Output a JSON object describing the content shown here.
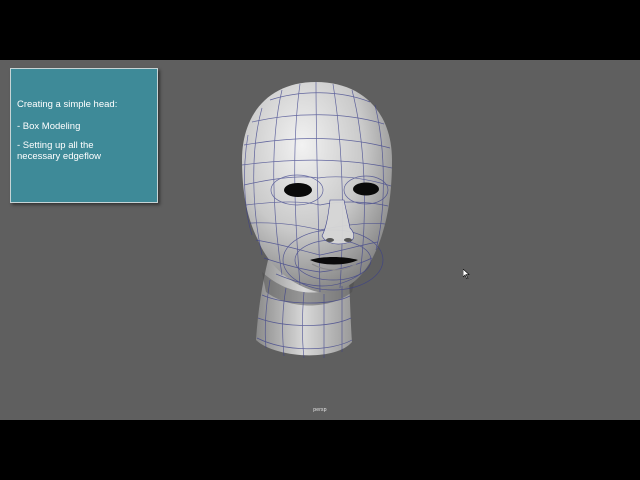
{
  "overlay": {
    "title": "Creating a simple head:",
    "bullets": [
      "- Box Modeling",
      "- Setting up all the\nnecessary edgeflow"
    ]
  },
  "viewport": {
    "camera_label": "persp",
    "background_color": "#5f5f5f",
    "panel_color": "#3e8a98",
    "wire_color": "#3a3f8a"
  },
  "icons": [
    "mouse-pointer-icon"
  ]
}
